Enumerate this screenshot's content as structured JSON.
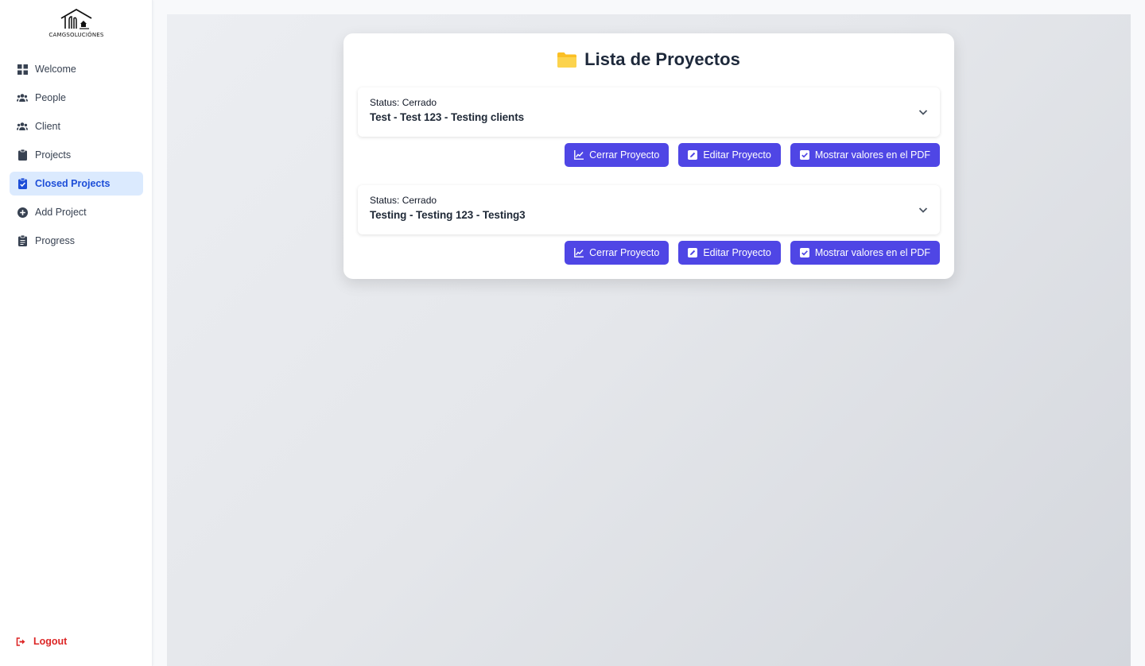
{
  "brand": {
    "name": "CAMGSOLUCIÓNES"
  },
  "sidebar": {
    "items": [
      {
        "label": "Welcome",
        "icon": "grid-icon",
        "active": false
      },
      {
        "label": "People",
        "icon": "users-icon",
        "active": false
      },
      {
        "label": "Client",
        "icon": "users-icon",
        "active": false
      },
      {
        "label": "Projects",
        "icon": "clipboard-icon",
        "active": false
      },
      {
        "label": "Closed Projects",
        "icon": "clipboard-check-icon",
        "active": true
      },
      {
        "label": "Add Project",
        "icon": "plus-circle-icon",
        "active": false
      },
      {
        "label": "Progress",
        "icon": "clipboard-list-icon",
        "active": false
      }
    ],
    "logout_label": "Logout"
  },
  "main": {
    "title": "Lista de Proyectos",
    "projects": [
      {
        "status": "Status: Cerrado",
        "name": "Test - Test 123 - Testing clients",
        "buttons": {
          "close": "Cerrar Proyecto",
          "edit": "Editar Proyecto",
          "pdf": "Mostrar valores en el PDF"
        }
      },
      {
        "status": "Status: Cerrado",
        "name": "Testing - Testing 123 - Testing3",
        "buttons": {
          "close": "Cerrar Proyecto",
          "edit": "Editar Proyecto",
          "pdf": "Mostrar valores en el PDF"
        }
      }
    ]
  },
  "colors": {
    "accent": "#4f46e5",
    "active_bg": "#dbeafe",
    "active_text": "#1d4ed8",
    "logout": "#dc2626",
    "folder": "#fbbf24"
  }
}
